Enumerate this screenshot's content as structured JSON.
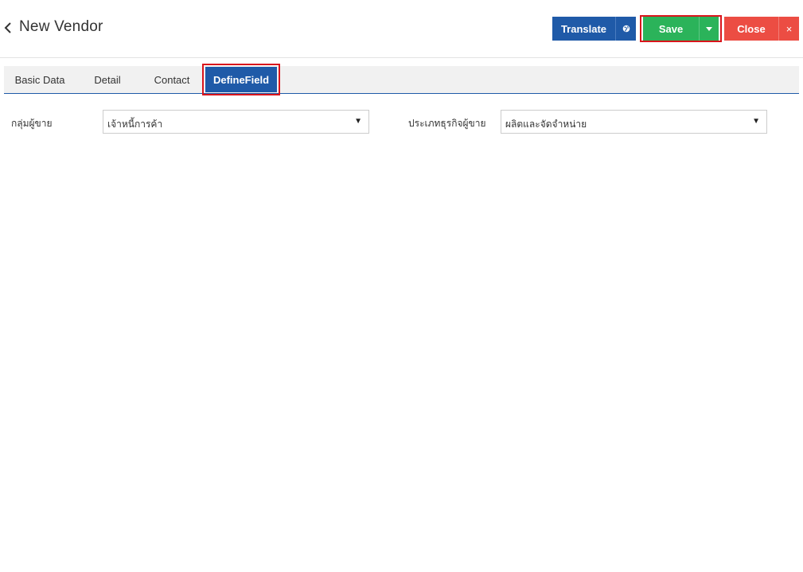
{
  "header": {
    "title": "New Vendor",
    "back_icon": "chevron-left-icon"
  },
  "toolbar": {
    "translate_label": "Translate",
    "translate_icon": "globe-icon",
    "save_label": "Save",
    "save_dropdown_icon": "caret-down-icon",
    "close_label": "Close",
    "close_x_label": "×"
  },
  "tabs": [
    {
      "label": "Basic Data",
      "active": false
    },
    {
      "label": "Detail",
      "active": false
    },
    {
      "label": "Contact",
      "active": false
    },
    {
      "label": "DefineField",
      "active": true
    }
  ],
  "form": {
    "vendor_group": {
      "label": "กลุ่มผู้ขาย",
      "value": "เจ้าหนี้การค้า"
    },
    "business_type": {
      "label": "ประเภทธุรกิจผู้ขาย",
      "value": "ผลิตและจัดจำหน่าย"
    },
    "dropdown_arrow": "▼"
  },
  "colors": {
    "primary_blue": "#1f5aa8",
    "save_green": "#2bb35a",
    "close_red": "#ec4d43",
    "highlight_red": "#d9151c"
  }
}
